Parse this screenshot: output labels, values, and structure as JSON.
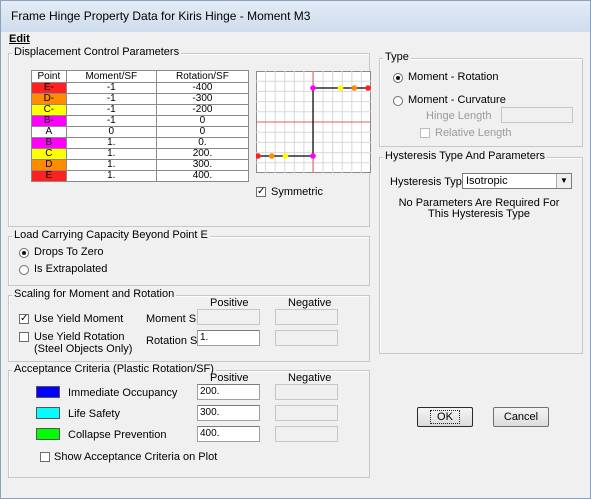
{
  "window": {
    "title": "Frame Hinge Property Data for Kiris Hinge - Moment M3"
  },
  "menu": {
    "edit": "Edit"
  },
  "displacement": {
    "label": "Displacement Control Parameters",
    "columns": [
      "Point",
      "Moment/SF",
      "Rotation/SF"
    ],
    "rows": [
      {
        "point": "E-",
        "moment": "-1",
        "rotation": "-400",
        "color": "#ff2020"
      },
      {
        "point": "D-",
        "moment": "-1",
        "rotation": "-300",
        "color": "#ff8c00"
      },
      {
        "point": "C-",
        "moment": "-1",
        "rotation": "-200",
        "color": "#ffff00"
      },
      {
        "point": "B-",
        "moment": "-1",
        "rotation": "0",
        "color": "#ff00ff"
      },
      {
        "point": "A",
        "moment": "0",
        "rotation": "0",
        "color": "#ffffff"
      },
      {
        "point": "B",
        "moment": "1.",
        "rotation": "0.",
        "color": "#ff00ff"
      },
      {
        "point": "C",
        "moment": "1.",
        "rotation": "200.",
        "color": "#ffff00"
      },
      {
        "point": "D",
        "moment": "1.",
        "rotation": "300.",
        "color": "#ff8c00"
      },
      {
        "point": "E",
        "moment": "1.",
        "rotation": "400.",
        "color": "#ff2020"
      }
    ],
    "symmetric_label": "Symmetric",
    "symmetric_checked": true
  },
  "load_capacity": {
    "label": "Load Carrying Capacity Beyond Point E",
    "drops": "Drops To Zero",
    "extrapolated": "Is Extrapolated",
    "selected": "drops"
  },
  "scaling": {
    "label": "Scaling for Moment and Rotation",
    "positive": "Positive",
    "negative": "Negative",
    "use_yield_moment": "Use Yield Moment",
    "use_yield_moment_checked": true,
    "moment_sf": "Moment SF",
    "use_yield_rotation_1": "Use Yield Rotation",
    "use_yield_rotation_2": "(Steel Objects Only)",
    "use_yield_rotation_checked": false,
    "rotation_sf": "Rotation SF",
    "rotation_sf_value": "1."
  },
  "acceptance": {
    "label": "Acceptance Criteria (Plastic Rotation/SF)",
    "positive": "Positive",
    "negative": "Negative",
    "items": [
      {
        "label": "Immediate Occupancy",
        "value": "200.",
        "color": "#0000ff"
      },
      {
        "label": "Life Safety",
        "value": "300.",
        "color": "#00ffff"
      },
      {
        "label": "Collapse Prevention",
        "value": "400.",
        "color": "#00ff00"
      }
    ],
    "show_on_plot": "Show Acceptance Criteria on Plot"
  },
  "type": {
    "label": "Type",
    "moment_rotation": "Moment - Rotation",
    "moment_curvature": "Moment - Curvature",
    "hinge_length": "Hinge Length",
    "relative_length": "Relative Length",
    "selected": "moment_rotation"
  },
  "hysteresis": {
    "label": "Hysteresis Type And Parameters",
    "type_label": "Hysteresis Type",
    "type_value": "Isotropic",
    "note": "No Parameters Are Required For This Hysteresis Type"
  },
  "buttons": {
    "ok": "OK",
    "cancel": "Cancel"
  },
  "icons": {
    "check": "✓",
    "dropdown": "▼"
  }
}
